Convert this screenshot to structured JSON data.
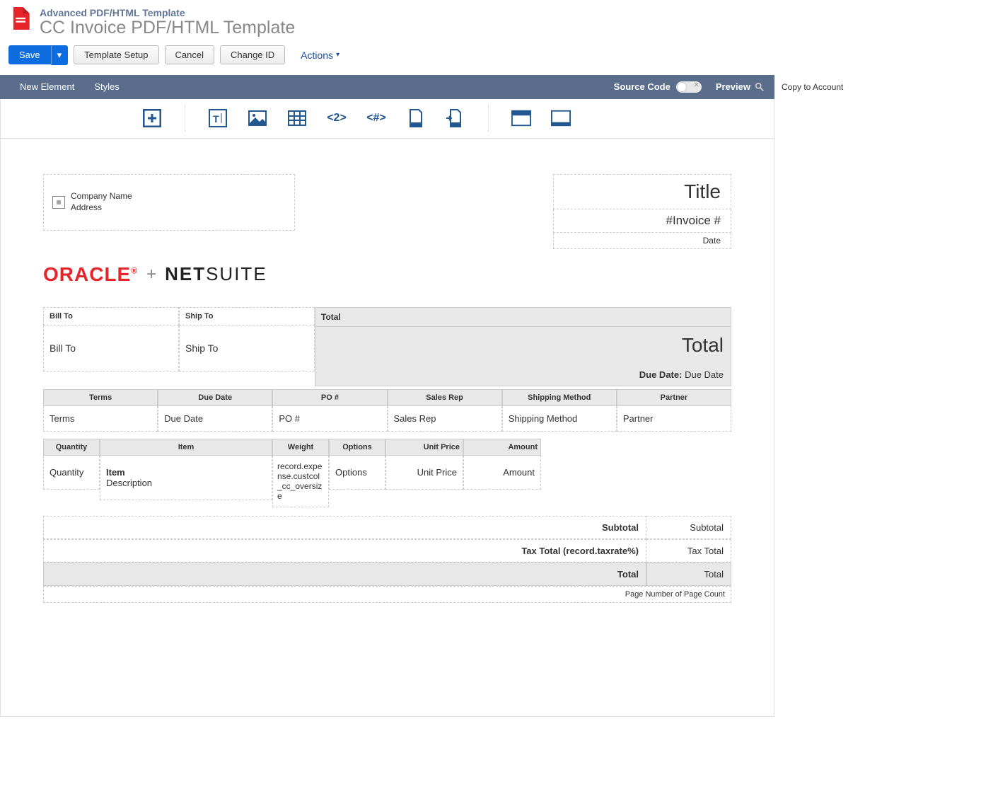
{
  "header": {
    "super": "Advanced PDF/HTML Template",
    "title": "CC Invoice PDF/HTML Template"
  },
  "toolbar": {
    "save": "Save",
    "template_setup": "Template Setup",
    "cancel": "Cancel",
    "change_id": "Change ID",
    "actions": "Actions",
    "copy_to_account": "Copy to Account"
  },
  "subnav": {
    "new_element": "New Element",
    "styles": "Styles",
    "source_code": "Source Code",
    "preview": "Preview"
  },
  "template": {
    "company_name": "Company Name",
    "address": "Address",
    "title": "Title",
    "invoice_num": "#Invoice #",
    "date": "Date",
    "oracle": "ORACLE",
    "plus": "+",
    "netsuite_bold": "NET",
    "netsuite_light": "SUITE",
    "bill_to_head": "Bill To",
    "ship_to_head": "Ship To",
    "bill_to_val": "Bill To",
    "ship_to_val": "Ship To",
    "total_head": "Total",
    "total_big": "Total",
    "due_date_label": "Due Date:",
    "due_date_val": "Due Date",
    "info": {
      "headers": [
        "Terms",
        "Due Date",
        "PO #",
        "Sales Rep",
        "Shipping Method",
        "Partner"
      ],
      "values": [
        "Terms",
        "Due Date",
        "PO #",
        "Sales Rep",
        "Shipping Method",
        "Partner"
      ]
    },
    "items": {
      "headers": [
        "Quantity",
        "Item",
        "Weight",
        "Options",
        "Unit Price",
        "Amount"
      ],
      "row": {
        "qty": "Quantity",
        "item_name": "Item",
        "item_desc": "Description",
        "weight": "record.expense.custcol_cc_oversize",
        "options": "Options",
        "unit_price": "Unit Price",
        "amount": "Amount"
      }
    },
    "totals": {
      "subtotal_lbl": "Subtotal",
      "subtotal_val": "Subtotal",
      "tax_lbl": "Tax Total (record.taxrate%)",
      "tax_val": "Tax Total",
      "total_lbl": "Total",
      "total_val": "Total"
    },
    "page_num": "Page Number of Page Count"
  }
}
